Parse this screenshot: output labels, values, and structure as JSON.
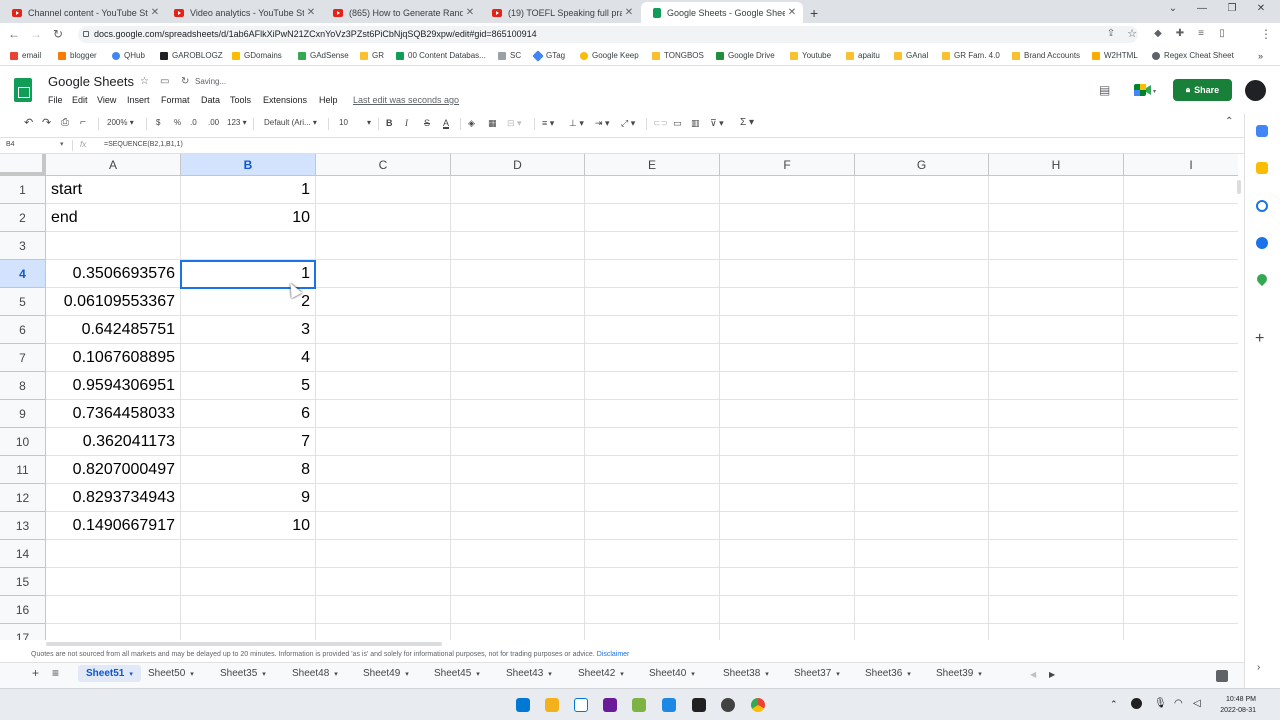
{
  "browser": {
    "tabs": [
      {
        "title": "Channel content - YouTube Studi",
        "kind": "youtube"
      },
      {
        "title": "Video analytics - YouTube Studio",
        "kind": "youtube"
      },
      {
        "title": "(865) How to Generate Random",
        "kind": "youtube"
      },
      {
        "title": "(19) TOEFL Speaking full practice",
        "kind": "youtube"
      },
      {
        "title": "Google Sheets - Google Sheets",
        "kind": "sheets",
        "active": true
      }
    ],
    "new_tab": "+",
    "url": "docs.google.com/spreadsheets/d/1ab6AFlkXiPwN21ZCxnYoVz3PZst6PiCbNjqSQB29xpw/edit#gid=865100914",
    "bookmarks": [
      "email",
      "blogger",
      "QHub",
      "GAROBLOGZ",
      "GDomains",
      "GAdSense",
      "GR",
      "00 Content Databas...",
      "SC",
      "GTag",
      "Google Keep",
      "TONGBOS",
      "Google Drive",
      "Youtube",
      "apaitu",
      "GAnal",
      "GR Fam. 4.0",
      "Brand Accounts",
      "W2HTML",
      "Regex Cheat Sheet"
    ]
  },
  "app": {
    "title": "Google Sheets",
    "saving": "Saving...",
    "menus": [
      "File",
      "Edit",
      "View",
      "Insert",
      "Format",
      "Data",
      "Tools",
      "Extensions",
      "Help"
    ],
    "last_edit": "Last edit was seconds ago",
    "share": "Share"
  },
  "toolbar": {
    "zoom": "200%",
    "currency": "$",
    "percent": "%",
    "dec_decrease": ".0",
    "dec_increase": ".00",
    "format_123": "123",
    "font": "Default (Ari...",
    "font_size": "10",
    "bold": "B",
    "italic": "I",
    "strike": "S",
    "text_color": "A",
    "functions": "Σ"
  },
  "formula_bar": {
    "name_box": "B4",
    "fx": "fx",
    "formula": "=SEQUENCE(B2,1,B1,1)"
  },
  "grid": {
    "columns": [
      "A",
      "B",
      "C",
      "D",
      "E",
      "F",
      "G",
      "H",
      "I"
    ],
    "selected_column": "B",
    "selected_row": 4,
    "rows": [
      {
        "n": "1",
        "a": "start",
        "b": "1"
      },
      {
        "n": "2",
        "a": "end",
        "b": "10"
      },
      {
        "n": "3",
        "a": "",
        "b": ""
      },
      {
        "n": "4",
        "a": "0.3506693576",
        "b": "1"
      },
      {
        "n": "5",
        "a": "0.06109553367",
        "b": "2"
      },
      {
        "n": "6",
        "a": "0.642485751",
        "b": "3"
      },
      {
        "n": "7",
        "a": "0.1067608895",
        "b": "4"
      },
      {
        "n": "8",
        "a": "0.9594306951",
        "b": "5"
      },
      {
        "n": "9",
        "a": "0.7364458033",
        "b": "6"
      },
      {
        "n": "10",
        "a": "0.362041173",
        "b": "7"
      },
      {
        "n": "11",
        "a": "0.8207000497",
        "b": "8"
      },
      {
        "n": "12",
        "a": "0.8293734943",
        "b": "9"
      },
      {
        "n": "13",
        "a": "0.1490667917",
        "b": "10"
      },
      {
        "n": "14",
        "a": "",
        "b": ""
      },
      {
        "n": "15",
        "a": "",
        "b": ""
      },
      {
        "n": "16",
        "a": "",
        "b": ""
      },
      {
        "n": "17",
        "a": "",
        "b": ""
      }
    ]
  },
  "quotes": {
    "text": "Quotes are not sourced from all markets and may be delayed up to 20 minutes. Information is provided 'as is' and solely for informational purposes, not for trading purposes or advice.",
    "link": "Disclaimer"
  },
  "sheet_tabs": {
    "add": "+",
    "all": "≡",
    "tabs": [
      "Sheet51",
      "Sheet50",
      "Sheet35",
      "Sheet48",
      "Sheet49",
      "Sheet45",
      "Sheet43",
      "Sheet42",
      "Sheet40",
      "Sheet38",
      "Sheet37",
      "Sheet36",
      "Sheet39"
    ],
    "active": "Sheet51"
  },
  "taskbar": {
    "time": "10:48 PM",
    "date": "2022-08-31"
  },
  "colors": {
    "accent": "#1a73e8",
    "share": "#188038",
    "sheets_green": "#0f9d58"
  }
}
